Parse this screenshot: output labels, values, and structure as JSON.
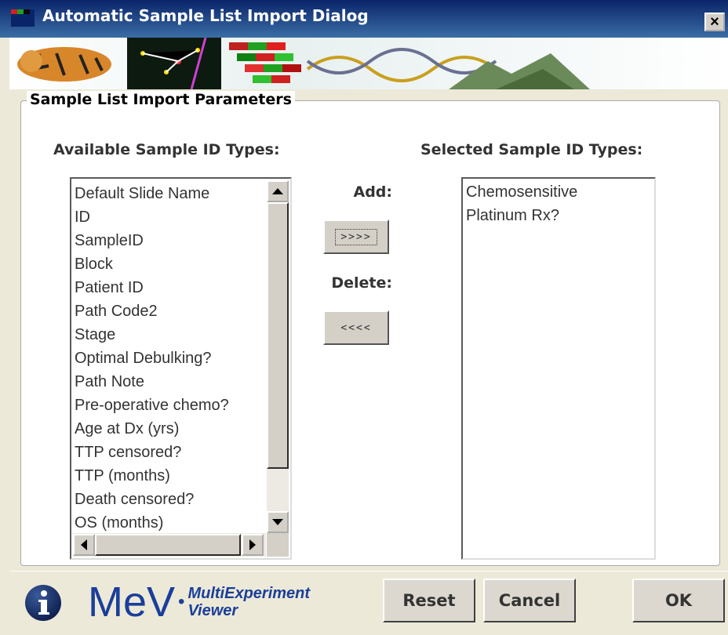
{
  "window": {
    "title": "Automatic Sample List Import Dialog",
    "close_glyph": "×"
  },
  "group": {
    "title": "Sample List Import Parameters"
  },
  "available": {
    "heading": "Available Sample ID Types:",
    "items": [
      "Default Slide Name",
      "ID",
      "SampleID",
      "Block",
      "Patient ID",
      "Path Code2",
      "Stage",
      "Optimal Debulking?",
      "Path Note",
      "Pre-operative chemo?",
      "Age at Dx (yrs)",
      "TTP censored?",
      "TTP (months)",
      "Death censored?",
      "OS (months)"
    ]
  },
  "selected": {
    "heading": "Selected Sample ID Types:",
    "items": [
      "Chemosensitive",
      "Platinum Rx?"
    ]
  },
  "controls": {
    "add_label": "Add:",
    "add_button": ">>>>",
    "delete_label": "Delete:",
    "delete_button": "<<<<"
  },
  "logo": {
    "name": "MeV",
    "dot": "•",
    "sub_line1": "MultiExperiment",
    "sub_line2": "Viewer",
    "color": "#1a3e9a"
  },
  "buttons": {
    "reset": "Reset",
    "cancel": "Cancel",
    "ok": "OK"
  },
  "icons": {
    "title": "mev-window-icon",
    "info": "info-icon",
    "close": "close-icon"
  }
}
